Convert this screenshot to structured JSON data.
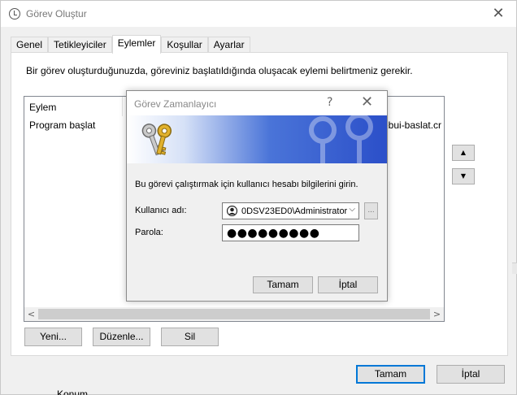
{
  "window": {
    "title": "Görev Oluştur",
    "close_glyph": "✕"
  },
  "tabs": [
    {
      "label": "Genel",
      "active": false
    },
    {
      "label": "Tetikleyiciler",
      "active": false
    },
    {
      "label": "Eylemler",
      "active": true
    },
    {
      "label": "Koşullar",
      "active": false
    },
    {
      "label": "Ayarlar",
      "active": false
    }
  ],
  "actions_panel": {
    "description": "Bir görev oluşturduğunuzda, göreviniz başlatıldığında oluşacak eylemi belirtmeniz gerekir.",
    "columns": [
      "Eylem"
    ],
    "rows": [
      {
        "action": "Program başlat",
        "detail_tail": "ebui-baslat.cr"
      }
    ],
    "move_up_glyph": "▲",
    "move_down_glyph": "▼",
    "scroll_left_glyph": "<",
    "scroll_right_glyph": ">",
    "buttons": {
      "new": "Yeni...",
      "edit": "Düzenle...",
      "delete": "Sil"
    }
  },
  "footer": {
    "ok": "Tamam",
    "cancel": "İptal"
  },
  "background_peek_text": "Konum",
  "credential_dialog": {
    "title": "Görev Zamanlayıcı",
    "help_glyph": "?",
    "close_glyph": "✕",
    "instruction": "Bu görevi çalıştırmak için kullanıcı hesabı bilgilerini girin.",
    "username_label": "Kullanıcı adı:",
    "username_value": "0DSV23ED0\\Administrator",
    "chevron_glyph": "⌵",
    "browse_label": "...",
    "password_label": "Parola:",
    "password_masked": "●●●●●●●●●",
    "ok": "Tamam",
    "cancel": "İptal"
  },
  "colors": {
    "accent": "#0078d7",
    "banner_start": "#ffffff",
    "banner_end": "#2b4fc9",
    "key_gold": "#e1b12c"
  },
  "icons": {
    "window": "clock-icon",
    "banner": "keys-icon",
    "user": "user-avatar-icon"
  }
}
